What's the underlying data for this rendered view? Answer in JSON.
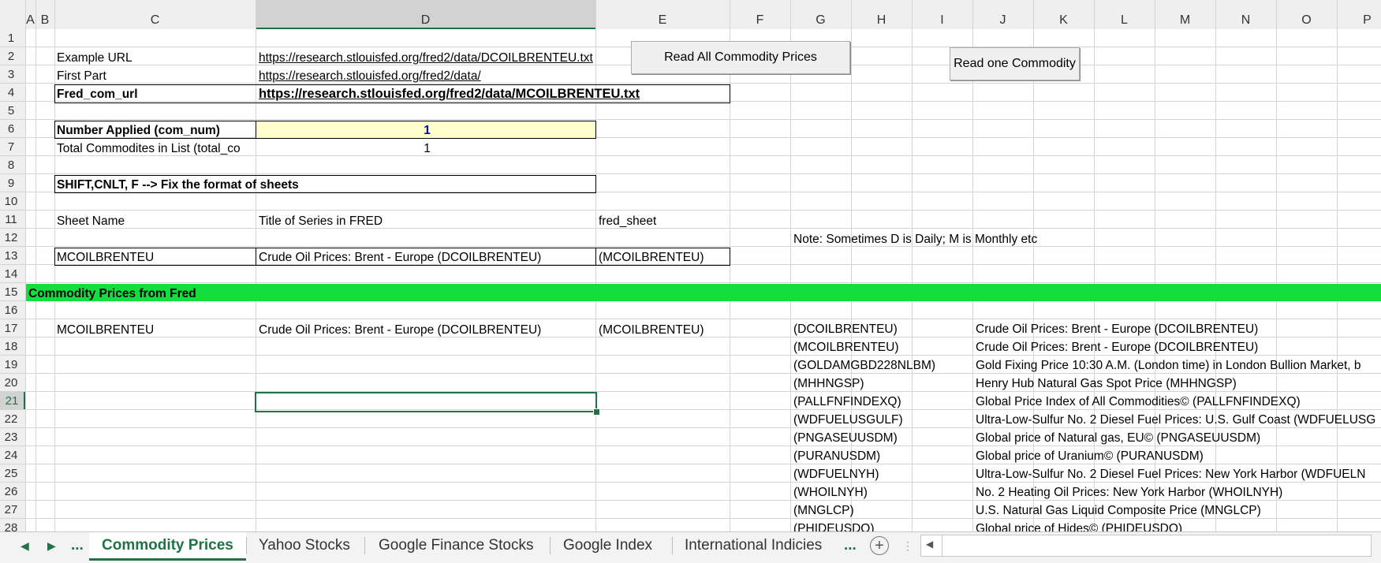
{
  "columns": [
    "A",
    "B",
    "C",
    "D",
    "E",
    "F",
    "G",
    "H",
    "I",
    "J",
    "K",
    "L",
    "M",
    "N",
    "O",
    "P"
  ],
  "selected_column": "D",
  "rows": [
    "1",
    "2",
    "3",
    "4",
    "5",
    "6",
    "7",
    "8",
    "9",
    "10",
    "11",
    "12",
    "13",
    "14",
    "15",
    "16",
    "17",
    "18",
    "19",
    "20",
    "21",
    "22",
    "23",
    "24",
    "25",
    "26",
    "27",
    "28"
  ],
  "selected_row": "21",
  "cells": {
    "c2": "Example URL",
    "d2": "https://research.stlouisfed.org/fred2/data/DCOILBRENTEU.txt",
    "c3": "First Part",
    "d3": "https://research.stlouisfed.org/fred2/data/",
    "c4": "Fred_com_url",
    "d4": "https://research.stlouisfed.org/fred2/data/MCOILBRENTEU.txt",
    "c6": "Number Applied (com_num)",
    "d6": "1",
    "c7": "Total Commodites in List (total_co",
    "d7": "1",
    "c9": "SHIFT,CNLT, F --> Fix the format of sheets",
    "c11": "Sheet Name",
    "d11": "Title of Series in FRED",
    "e11": "fred_sheet",
    "g12": "Note: Sometimes D is Daily; M is Monthly etc",
    "c13": "MCOILBRENTEU",
    "d13": "Crude Oil Prices: Brent - Europe (DCOILBRENTEU)",
    "e13": "(MCOILBRENTEU)",
    "a15": "Commodity Prices from Fred",
    "c17": "MCOILBRENTEU",
    "d17": "Crude Oil Prices: Brent - Europe (DCOILBRENTEU)",
    "e17": "(MCOILBRENTEU)"
  },
  "commodity_list": [
    {
      "code": "(DCOILBRENTEU)",
      "title": "Crude Oil Prices: Brent - Europe (DCOILBRENTEU)"
    },
    {
      "code": "(MCOILBRENTEU)",
      "title": "Crude Oil Prices: Brent - Europe (DCOILBRENTEU)"
    },
    {
      "code": "(GOLDAMGBD228NLBM)",
      "title": " Gold Fixing Price 10:30 A.M. (London time) in London Bullion Market, b"
    },
    {
      "code": "(MHHNGSP)",
      "title": "Henry Hub Natural Gas Spot Price (MHHNGSP)"
    },
    {
      "code": "(PALLFNFINDEXQ)",
      "title": " Global Price Index of All Commodities© (PALLFNFINDEXQ)"
    },
    {
      "code": "(WDFUELUSGULF)",
      "title": " Ultra-Low-Sulfur No. 2 Diesel Fuel Prices: U.S. Gulf Coast (WDFUELUSG"
    },
    {
      "code": "(PNGASEUUSDM)",
      "title": " Global price of Natural gas, EU© (PNGASEUUSDM)"
    },
    {
      "code": "(PURANUSDM)",
      "title": "Global price of Uranium© (PURANUSDM)"
    },
    {
      "code": "(WDFUELNYH)",
      "title": "Ultra-Low-Sulfur No. 2 Diesel Fuel Prices: New York Harbor (WDFUELN"
    },
    {
      "code": "(WHOILNYH)",
      "title": " No. 2 Heating Oil Prices: New York Harbor (WHOILNYH)"
    },
    {
      "code": "(MNGLCP)",
      "title": "U.S. Natural Gas Liquid Composite Price (MNGLCP)"
    },
    {
      "code": "(PHIDEUSDQ)",
      "title": "Global price of Hides© (PHIDEUSDQ)"
    }
  ],
  "buttons": {
    "read_all": "Read All Commodity Prices",
    "read_one": "Read one Commodity"
  },
  "tabs": {
    "ellipsis_left": "...",
    "items": [
      "Commodity Prices",
      "Yahoo Stocks",
      "Google Finance Stocks",
      "Google Index",
      "International Indicies"
    ],
    "ellipsis_right": "...",
    "add": "+"
  },
  "colors": {
    "green_bar": "#13df3c",
    "input_yellow": "#ffffcc",
    "active_tab": "#217346",
    "number_blue": "#0000cc"
  }
}
